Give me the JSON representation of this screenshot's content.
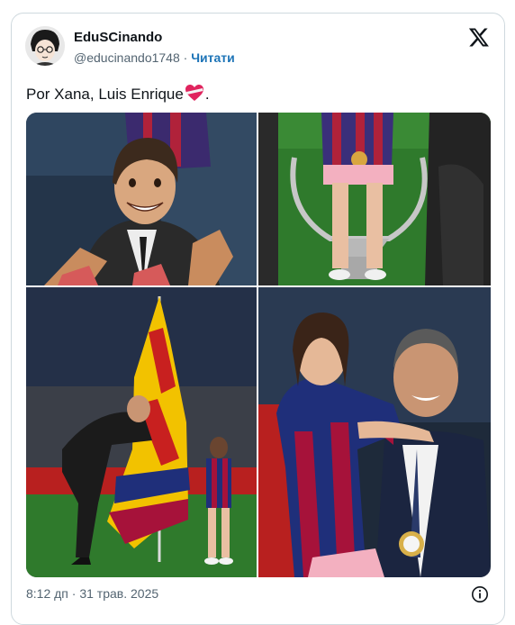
{
  "tweet": {
    "author": {
      "display_name": "EduSCinando",
      "handle": "@educinando1748",
      "separator": "·",
      "follow_label": "Читати",
      "avatar_icon": "anime-avatar-icon"
    },
    "logo_icon": "x-logo-icon",
    "text_before": "Por Xana, Luis Enrique",
    "text_emoji": "heart-ribbon-emoji",
    "text_after": ".",
    "media": {
      "layout": "2x2-grid",
      "tiles": [
        "anime-illustration-man-carrying-girl",
        "girl-sitting-in-champions-league-trophy",
        "man-planting-catalan-flag-with-girl",
        "man-hugging-girl-in-barcelona-shirt"
      ]
    },
    "timestamp": "8:12 дп · 31 трав. 2025",
    "info_icon": "info-icon"
  },
  "colors": {
    "text": "#0f1419",
    "secondary_text": "#536471",
    "follow_link": "#1d74b7",
    "border": "#cfd9de",
    "barca_blue": "#1f2f7a",
    "barca_red": "#a6123a",
    "pitch_green": "#2f7a2c"
  }
}
